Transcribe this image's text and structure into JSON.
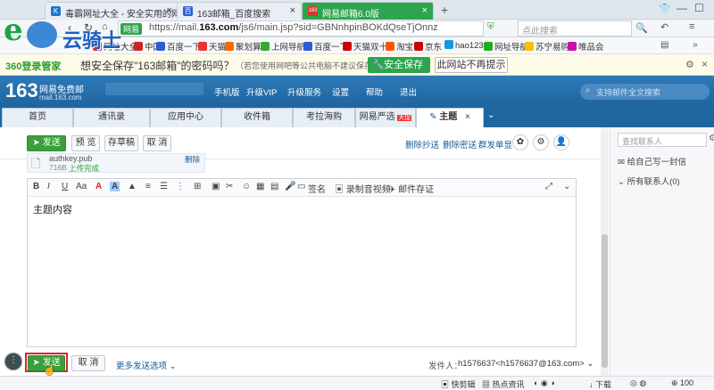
{
  "browser": {
    "tabs": [
      {
        "label": "毒霸网址大全 - 安全实用的网址",
        "favicon": "K"
      },
      {
        "label": "163邮箱_百度搜索",
        "favicon": "百"
      },
      {
        "label": "网易邮箱6.0版",
        "favicon": "163"
      }
    ],
    "new_tab": "+",
    "url_prefix": "https://mail.",
    "url_domain": "163.com",
    "url_rest": "/js6/main.jsp?sid=GBNnhpinBOKdQseTjOnnz",
    "security_badge": "网易",
    "search_placeholder": "点此搜索"
  },
  "logo": {
    "text": "云骑士"
  },
  "bookmarks": [
    "网址大全",
    "中国",
    "百度一下",
    "天猫",
    "聚划算",
    "上网导航",
    "百度一下",
    "天猫双十",
    "淘宝",
    "京东",
    "hao123",
    "网址导航",
    "苏宁易购",
    "唯品会"
  ],
  "bar360": {
    "brand": "360登录管家",
    "message": "想安全保存\"163邮箱\"的密码吗？",
    "note": "（若您使用网吧等公共电脑不建议保存）",
    "save_label": "安全保存",
    "dismiss_label": "此网站不再提示"
  },
  "mail": {
    "logo": "163",
    "logo_sub": "网易免费邮",
    "logo_domain": "mail.163.com",
    "nav": [
      "手机版",
      "升级VIP",
      "升级服务",
      "设置",
      "帮助",
      "退出"
    ],
    "search_placeholder": "支持邮件全文搜索",
    "tabs": [
      "首页",
      "通讯录",
      "应用中心",
      "收件箱",
      "考拉海购",
      "网易严选",
      "主题"
    ],
    "hot_badge": "大促"
  },
  "compose": {
    "send": "发送",
    "preview": "预 览",
    "draft": "存草稿",
    "cancel": "取 消",
    "delete_cc": "删除抄送",
    "delete_bcc": "删除密送",
    "separate": "群发单显",
    "attachment_name": "authkey.pub",
    "attachment_size": "716B",
    "attachment_status": "上传完成",
    "attachment_delete": "删除",
    "body_text": "主题内容",
    "more_options": "更多发送选项",
    "sender_label": "发件人：",
    "sender_value": "h1576637<h1576637@163.com>",
    "editor_tools": [
      "B",
      "I",
      "U",
      "Aa",
      "A",
      "A",
      "♠",
      "签名",
      "录制音视频",
      "邮件存证"
    ]
  },
  "contacts": {
    "search_placeholder": "查找联系人",
    "write_self": "给自己写一封信",
    "all_contacts": "所有联系人(0)"
  },
  "status": {
    "fast_clip": "快剪辑",
    "hot_news": "热点资讯",
    "download": "下载",
    "zoom": "100"
  }
}
